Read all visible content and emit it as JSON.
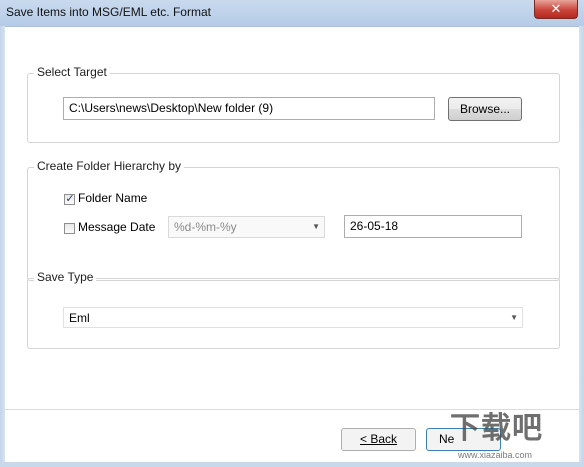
{
  "window": {
    "title": "Save Items into MSG/EML etc. Format",
    "close_glyph": "✕"
  },
  "select_target": {
    "legend": "Select Target",
    "path_value": "C:\\Users\\news\\Desktop\\New folder (9)",
    "browse_label": "Browse..."
  },
  "folder_hierarchy": {
    "legend": "Create Folder Hierarchy by",
    "folder_name_label": "Folder Name",
    "folder_name_checked": true,
    "message_date_label": "Message Date",
    "message_date_checked": false,
    "date_format_value": "%d-%m-%y",
    "date_preview_value": "26-05-18"
  },
  "save_type": {
    "legend": "Save Type",
    "selected_value": "Eml"
  },
  "footer": {
    "back_label": "< Back",
    "next_label": "Ne"
  },
  "watermark": {
    "text": "下载吧",
    "url": "www.xiazaiba.com"
  },
  "glyphs": {
    "check": "✓",
    "dropdown_arrow": "▼"
  }
}
